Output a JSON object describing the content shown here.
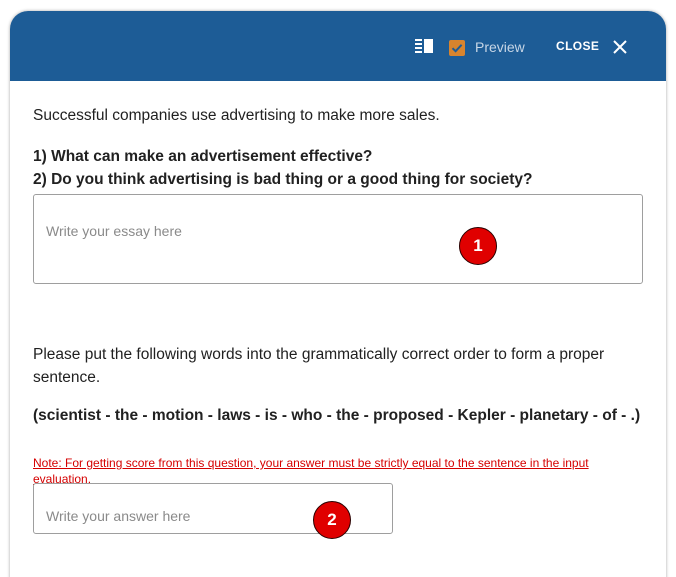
{
  "header": {
    "preview_label": "Preview",
    "preview_checked": true,
    "close_label": "CLOSE",
    "icons": {
      "layout": "layout-panel-icon",
      "close": "close-icon",
      "check": "checkmark-icon"
    },
    "colors": {
      "header_bg": "#1d5c96",
      "checkbox": "#d8842e"
    }
  },
  "essay": {
    "prompt": "Successful companies use advertising to make more sales.",
    "question_1": "1) What can make an advertisement effective?",
    "question_2": "2) Do you think advertising is bad thing or a good thing for society?",
    "placeholder": "Write your essay here",
    "badge": "1"
  },
  "ordering": {
    "instruction": "Please put the following words into the grammatically correct order to form a proper sentence.",
    "words": "(scientist - the - motion - laws - is - who - the - proposed - Kepler - planetary - of - .)",
    "note": "Note: For getting score from this question, your answer must be strictly equal to the sentence in the input evaluation.",
    "placeholder": "Write your answer here",
    "badge": "2"
  },
  "colors": {
    "badge": "#e00000",
    "note": "#d50000"
  }
}
